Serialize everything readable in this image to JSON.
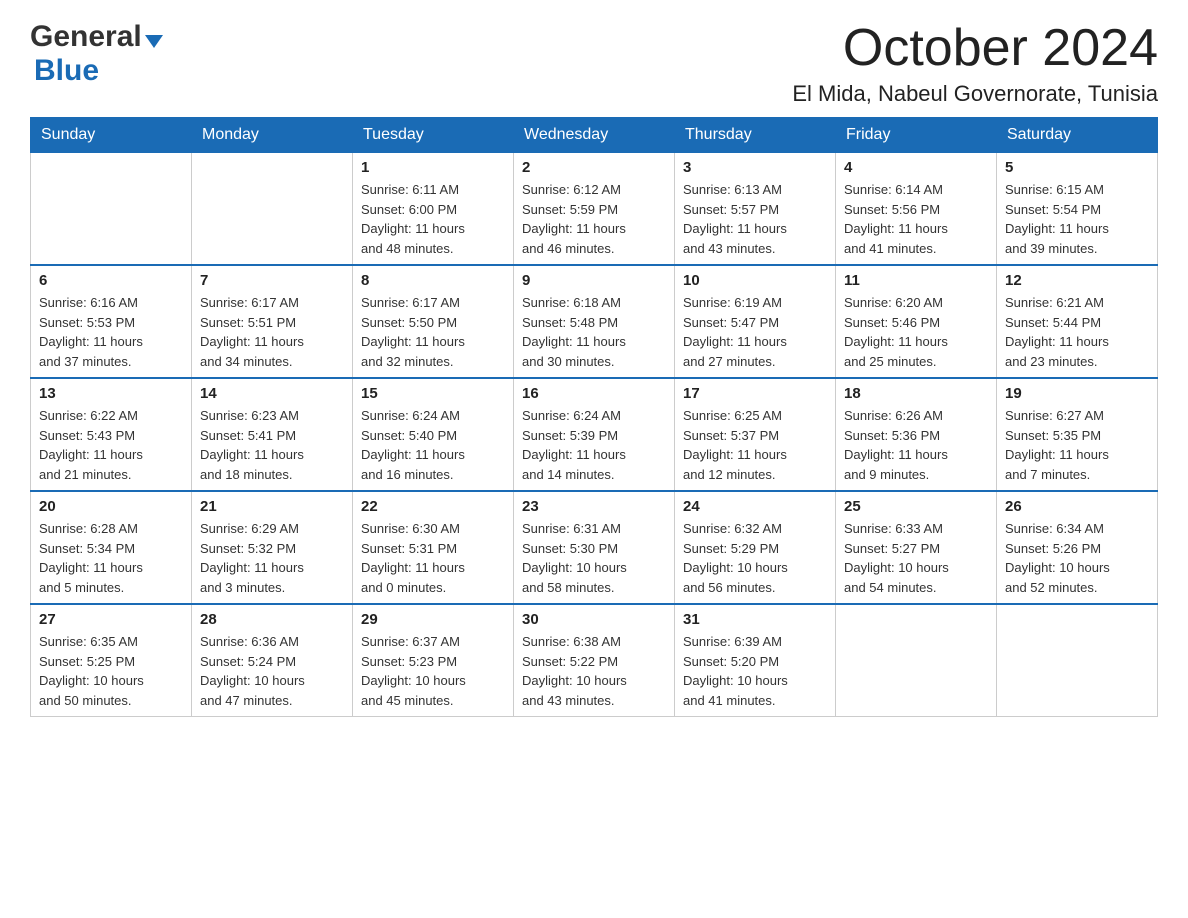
{
  "header": {
    "logo": {
      "general": "General",
      "triangle": "▶",
      "blue": "Blue"
    },
    "title": "October 2024",
    "subtitle": "El Mida, Nabeul Governorate, Tunisia"
  },
  "weekdays": [
    "Sunday",
    "Monday",
    "Tuesday",
    "Wednesday",
    "Thursday",
    "Friday",
    "Saturday"
  ],
  "weeks": [
    [
      {
        "day": "",
        "info": ""
      },
      {
        "day": "",
        "info": ""
      },
      {
        "day": "1",
        "info": "Sunrise: 6:11 AM\nSunset: 6:00 PM\nDaylight: 11 hours\nand 48 minutes."
      },
      {
        "day": "2",
        "info": "Sunrise: 6:12 AM\nSunset: 5:59 PM\nDaylight: 11 hours\nand 46 minutes."
      },
      {
        "day": "3",
        "info": "Sunrise: 6:13 AM\nSunset: 5:57 PM\nDaylight: 11 hours\nand 43 minutes."
      },
      {
        "day": "4",
        "info": "Sunrise: 6:14 AM\nSunset: 5:56 PM\nDaylight: 11 hours\nand 41 minutes."
      },
      {
        "day": "5",
        "info": "Sunrise: 6:15 AM\nSunset: 5:54 PM\nDaylight: 11 hours\nand 39 minutes."
      }
    ],
    [
      {
        "day": "6",
        "info": "Sunrise: 6:16 AM\nSunset: 5:53 PM\nDaylight: 11 hours\nand 37 minutes."
      },
      {
        "day": "7",
        "info": "Sunrise: 6:17 AM\nSunset: 5:51 PM\nDaylight: 11 hours\nand 34 minutes."
      },
      {
        "day": "8",
        "info": "Sunrise: 6:17 AM\nSunset: 5:50 PM\nDaylight: 11 hours\nand 32 minutes."
      },
      {
        "day": "9",
        "info": "Sunrise: 6:18 AM\nSunset: 5:48 PM\nDaylight: 11 hours\nand 30 minutes."
      },
      {
        "day": "10",
        "info": "Sunrise: 6:19 AM\nSunset: 5:47 PM\nDaylight: 11 hours\nand 27 minutes."
      },
      {
        "day": "11",
        "info": "Sunrise: 6:20 AM\nSunset: 5:46 PM\nDaylight: 11 hours\nand 25 minutes."
      },
      {
        "day": "12",
        "info": "Sunrise: 6:21 AM\nSunset: 5:44 PM\nDaylight: 11 hours\nand 23 minutes."
      }
    ],
    [
      {
        "day": "13",
        "info": "Sunrise: 6:22 AM\nSunset: 5:43 PM\nDaylight: 11 hours\nand 21 minutes."
      },
      {
        "day": "14",
        "info": "Sunrise: 6:23 AM\nSunset: 5:41 PM\nDaylight: 11 hours\nand 18 minutes."
      },
      {
        "day": "15",
        "info": "Sunrise: 6:24 AM\nSunset: 5:40 PM\nDaylight: 11 hours\nand 16 minutes."
      },
      {
        "day": "16",
        "info": "Sunrise: 6:24 AM\nSunset: 5:39 PM\nDaylight: 11 hours\nand 14 minutes."
      },
      {
        "day": "17",
        "info": "Sunrise: 6:25 AM\nSunset: 5:37 PM\nDaylight: 11 hours\nand 12 minutes."
      },
      {
        "day": "18",
        "info": "Sunrise: 6:26 AM\nSunset: 5:36 PM\nDaylight: 11 hours\nand 9 minutes."
      },
      {
        "day": "19",
        "info": "Sunrise: 6:27 AM\nSunset: 5:35 PM\nDaylight: 11 hours\nand 7 minutes."
      }
    ],
    [
      {
        "day": "20",
        "info": "Sunrise: 6:28 AM\nSunset: 5:34 PM\nDaylight: 11 hours\nand 5 minutes."
      },
      {
        "day": "21",
        "info": "Sunrise: 6:29 AM\nSunset: 5:32 PM\nDaylight: 11 hours\nand 3 minutes."
      },
      {
        "day": "22",
        "info": "Sunrise: 6:30 AM\nSunset: 5:31 PM\nDaylight: 11 hours\nand 0 minutes."
      },
      {
        "day": "23",
        "info": "Sunrise: 6:31 AM\nSunset: 5:30 PM\nDaylight: 10 hours\nand 58 minutes."
      },
      {
        "day": "24",
        "info": "Sunrise: 6:32 AM\nSunset: 5:29 PM\nDaylight: 10 hours\nand 56 minutes."
      },
      {
        "day": "25",
        "info": "Sunrise: 6:33 AM\nSunset: 5:27 PM\nDaylight: 10 hours\nand 54 minutes."
      },
      {
        "day": "26",
        "info": "Sunrise: 6:34 AM\nSunset: 5:26 PM\nDaylight: 10 hours\nand 52 minutes."
      }
    ],
    [
      {
        "day": "27",
        "info": "Sunrise: 6:35 AM\nSunset: 5:25 PM\nDaylight: 10 hours\nand 50 minutes."
      },
      {
        "day": "28",
        "info": "Sunrise: 6:36 AM\nSunset: 5:24 PM\nDaylight: 10 hours\nand 47 minutes."
      },
      {
        "day": "29",
        "info": "Sunrise: 6:37 AM\nSunset: 5:23 PM\nDaylight: 10 hours\nand 45 minutes."
      },
      {
        "day": "30",
        "info": "Sunrise: 6:38 AM\nSunset: 5:22 PM\nDaylight: 10 hours\nand 43 minutes."
      },
      {
        "day": "31",
        "info": "Sunrise: 6:39 AM\nSunset: 5:20 PM\nDaylight: 10 hours\nand 41 minutes."
      },
      {
        "day": "",
        "info": ""
      },
      {
        "day": "",
        "info": ""
      }
    ]
  ]
}
